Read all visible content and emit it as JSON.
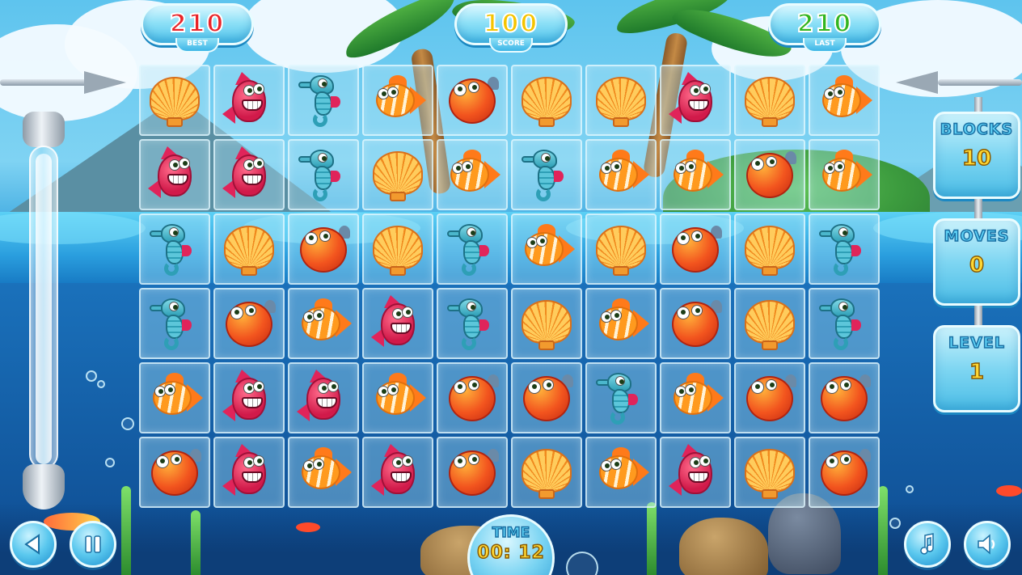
{
  "scores": {
    "best": {
      "value": "210",
      "label": "BEST"
    },
    "score": {
      "value": "100",
      "label": "SCORE"
    },
    "last": {
      "value": "210",
      "label": "LAST"
    }
  },
  "stats": {
    "blocks": {
      "label": "BLOCKS",
      "value": "10"
    },
    "moves": {
      "label": "MOVES",
      "value": "0"
    },
    "level": {
      "label": "LEVEL",
      "value": "1"
    }
  },
  "timer": {
    "label": "TIME",
    "value": "00: 12"
  },
  "meter": {
    "level": 0.97
  },
  "colors": {
    "best": "#e8242a",
    "score": "#f5c400",
    "last": "#33b51f"
  },
  "board": {
    "rows": [
      [
        "shell",
        "pink",
        "seahorse",
        "orange",
        "puffer",
        "shell",
        "shell",
        "pink",
        "shell",
        "orange"
      ],
      [
        "pink",
        "pink",
        "seahorse",
        "shell",
        "orange",
        "seahorse",
        "orange",
        "orange",
        "puffer",
        "orange"
      ],
      [
        "seahorse",
        "shell",
        "puffer",
        "shell",
        "seahorse",
        "orange",
        "shell",
        "puffer",
        "shell",
        "seahorse"
      ],
      [
        "seahorse",
        "puffer",
        "orange",
        "pink",
        "seahorse",
        "shell",
        "orange",
        "puffer",
        "shell",
        "seahorse"
      ],
      [
        "orange",
        "pink",
        "pink",
        "orange",
        "puffer",
        "puffer",
        "seahorse",
        "orange",
        "puffer",
        "puffer"
      ],
      [
        "puffer",
        "pink",
        "orange",
        "pink",
        "puffer",
        "shell",
        "orange",
        "pink",
        "shell",
        "puffer"
      ]
    ]
  },
  "buttons": {
    "back": "back-arrow-icon",
    "pause": "pause-icon",
    "music": "music-note-icon",
    "sound": "speaker-icon"
  }
}
